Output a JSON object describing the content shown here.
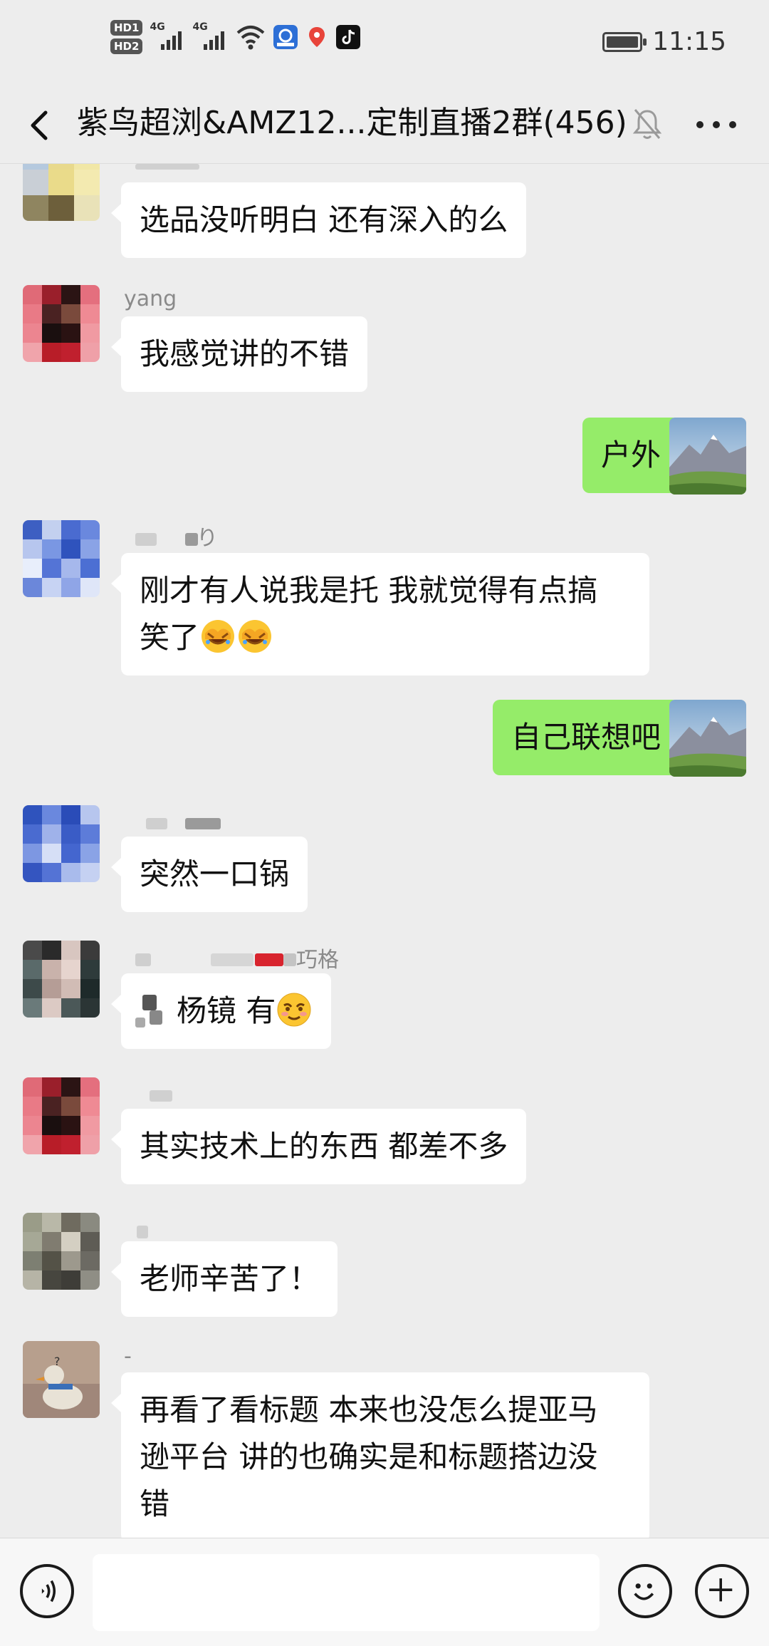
{
  "status_bar": {
    "hd1": "HD1",
    "hd2": "HD2",
    "net1": "4G",
    "net2": "4G",
    "time": "11:15",
    "icons": [
      "signal-icon",
      "wifi-icon",
      "app-notification-icon",
      "location-icon",
      "tiktok-icon",
      "battery-icon"
    ]
  },
  "header": {
    "title": "紫鸟超浏&AMZ12...定制直播2群(456)",
    "icons": [
      "back-arrow-icon",
      "mute-bell-icon",
      "more-dots-icon"
    ]
  },
  "messages": [
    {
      "side": "left",
      "sender": "",
      "text": "选品没听明白 还有深入的么"
    },
    {
      "side": "left",
      "sender": "yang",
      "text": "我感觉讲的不错"
    },
    {
      "side": "right",
      "sender": "",
      "text": "户外"
    },
    {
      "side": "left",
      "sender": "り",
      "text_line1": "刚才有人说我是托 我就觉得有点搞",
      "text_line2": "笑了",
      "emoji": "facepalm-emoji"
    },
    {
      "side": "right",
      "sender": "",
      "text": "自己联想吧"
    },
    {
      "side": "left",
      "sender": "",
      "text": "突然一口锅"
    },
    {
      "side": "left",
      "sender": "巧格",
      "text": "杨镜  有",
      "emoji": "smirk-emoji"
    },
    {
      "side": "left",
      "sender": "",
      "text": "其实技术上的东西 都差不多"
    },
    {
      "side": "left",
      "sender": "",
      "text": "老师辛苦了！"
    },
    {
      "side": "left",
      "sender": "-",
      "text_line1": "再看了看标题 本来也没怎么提亚马",
      "text_line2": "逊平台 讲的也确实是和标题搭边没",
      "text_line3": "错"
    }
  ],
  "input_bar": {
    "icons": [
      "voice-icon",
      "emoji-icon",
      "plus-icon"
    ],
    "text_value": ""
  },
  "colors": {
    "background": "#ededed",
    "bubble_self": "#95ec69",
    "bubble_other": "#ffffff"
  }
}
